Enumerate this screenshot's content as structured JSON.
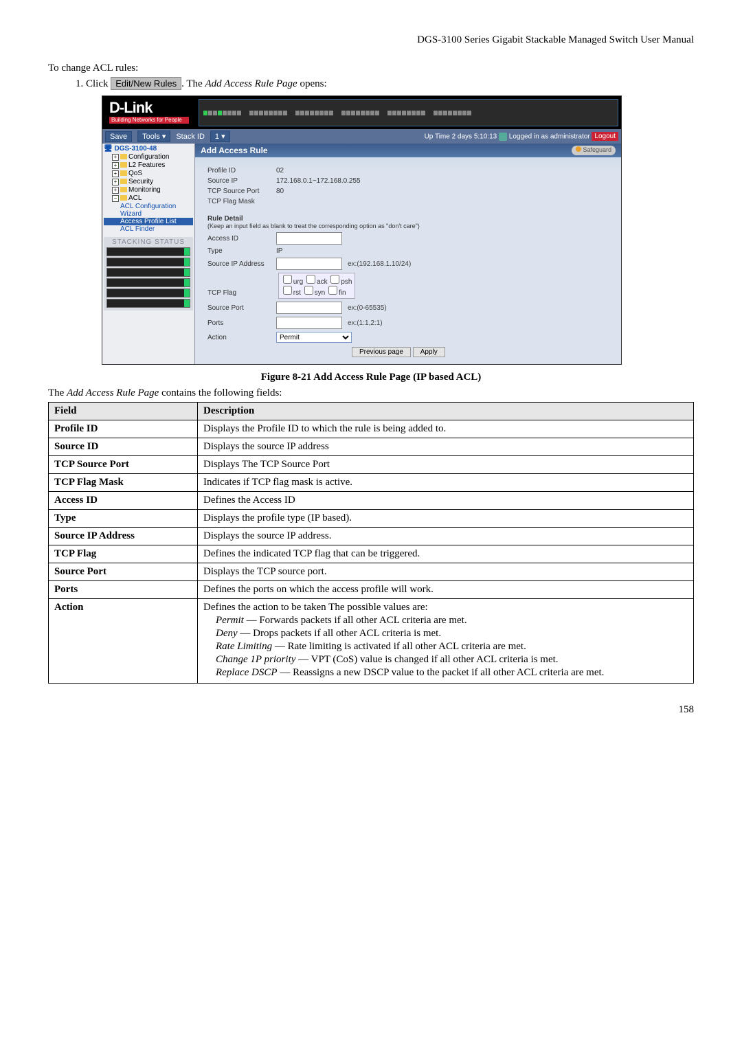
{
  "header": {
    "manual_title": "DGS-3100 Series Gigabit Stackable Managed Switch User Manual"
  },
  "intro": {
    "line1": "To change ACL rules:",
    "step_prefix": "1.    Click",
    "button_label": "Edit/New Rules",
    "step_suffix1": ". The ",
    "step_page_name": "Add Access Rule Page",
    "step_suffix2": " opens:"
  },
  "shot": {
    "logo": "D-Link",
    "tagline": "Building Networks for People",
    "toolbar": {
      "save": "Save",
      "tools": "Tools",
      "stackid_label": "Stack ID",
      "stackid_value": "1",
      "uptime": "Up Time 2 days 5:10:13",
      "login": "Logged in as administrator",
      "logout": "Logout"
    },
    "nav": {
      "root": "DGS-3100-48",
      "items": [
        "Configuration",
        "L2 Features",
        "QoS",
        "Security",
        "Monitoring",
        "ACL"
      ],
      "acl_sub": [
        "ACL Configuration Wizard",
        "Access Profile List",
        "ACL Finder"
      ]
    },
    "panel": {
      "title": "Add Access Rule",
      "safeguard": "Safeguard",
      "profile_id_lbl": "Profile ID",
      "profile_id_val": "02",
      "source_ip_lbl": "Source IP",
      "source_ip_val": "172.168.0.1~172.168.0.255",
      "tcp_src_port_lbl": "TCP Source Port",
      "tcp_src_port_val": "80",
      "tcp_flag_mask_lbl": "TCP Flag Mask",
      "rule_detail": "Rule Detail",
      "hint": "(Keep an input field as blank to treat the corresponding option as \"don't care\")",
      "access_id_lbl": "Access ID",
      "type_lbl": "Type",
      "type_val": "IP",
      "src_ip_addr_lbl": "Source IP Address",
      "src_ip_ex": "ex:(192.168.1.10/24)",
      "tcp_flag_lbl": "TCP Flag",
      "flags": [
        "urg",
        "ack",
        "psh",
        "rst",
        "syn",
        "fin"
      ],
      "src_port_lbl": "Source Port",
      "src_port_ex": "ex:(0-65535)",
      "ports_lbl": "Ports",
      "ports_ex": "ex:(1:1,2:1)",
      "action_lbl": "Action",
      "action_val": "Permit",
      "prev_btn": "Previous page",
      "apply_btn": "Apply"
    },
    "stacking_title": "STACKING STATUS"
  },
  "figure_caption": "Figure 8-21 Add Access Rule Page (IP based ACL)",
  "intro2": {
    "prefix": "The ",
    "page_name": "Add Access Rule Page",
    "suffix": " contains the following fields:"
  },
  "table": {
    "head_field": "Field",
    "head_desc": "Description",
    "rows": [
      {
        "f": "Profile ID",
        "d": "Displays the Profile ID to which the rule is being added to."
      },
      {
        "f": "Source ID",
        "d": "Displays the source IP address"
      },
      {
        "f": "TCP Source Port",
        "d": "Displays The TCP Source Port"
      },
      {
        "f": "TCP Flag Mask",
        "d": "Indicates if TCP flag mask is active."
      },
      {
        "f": "Access ID",
        "d": "Defines the Access ID"
      },
      {
        "f": "Type",
        "d": "Displays the profile type (IP based)."
      },
      {
        "f": "Source IP Address",
        "d": "Displays the source IP address."
      },
      {
        "f": "TCP Flag",
        "d": "Defines the indicated TCP flag that can be triggered."
      },
      {
        "f": "Source Port",
        "d": "Displays the TCP source port."
      },
      {
        "f": "Ports",
        "d": "Defines the ports on which the access profile will work."
      }
    ],
    "action_row": {
      "f": "Action",
      "lead": "Defines the action to be taken The possible values are:",
      "opts": [
        {
          "name": "Permit",
          "desc": " — Forwards packets if all other ACL criteria are met."
        },
        {
          "name": "Deny",
          "desc": " — Drops packets if all other ACL criteria is met."
        },
        {
          "name": "Rate Limiting",
          "desc": " — Rate limiting is activated if all other ACL criteria are met."
        },
        {
          "name": "Change 1P priority",
          "desc": " — VPT (CoS) value is changed if all other ACL criteria is met."
        },
        {
          "name": "Replace DSCP",
          "desc": " — Reassigns a new DSCP value to the packet if all other ACL criteria are met."
        }
      ]
    }
  },
  "page_number": "158"
}
